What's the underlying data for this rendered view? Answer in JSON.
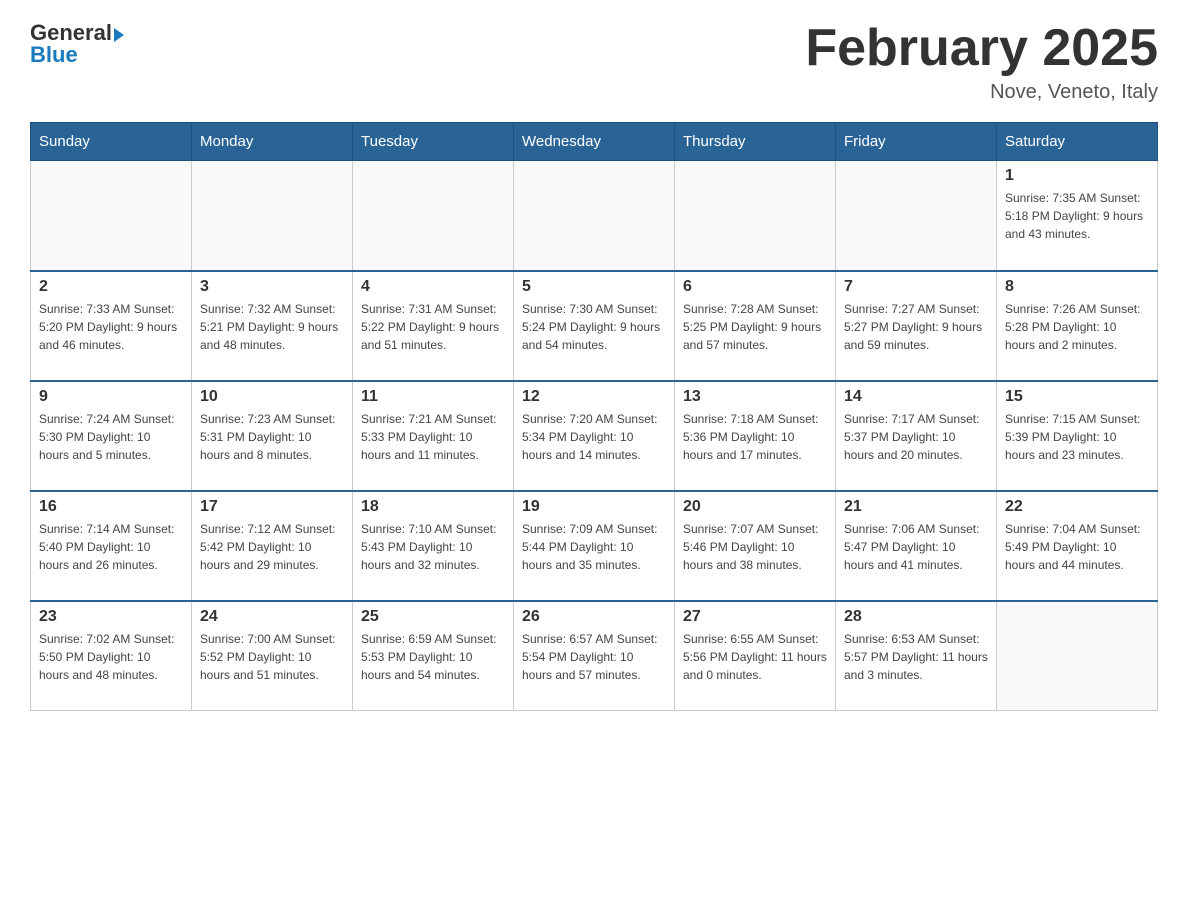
{
  "header": {
    "logo_general": "General",
    "logo_blue": "Blue",
    "month_title": "February 2025",
    "location": "Nove, Veneto, Italy"
  },
  "days_of_week": [
    "Sunday",
    "Monday",
    "Tuesday",
    "Wednesday",
    "Thursday",
    "Friday",
    "Saturday"
  ],
  "weeks": [
    [
      {
        "day": "",
        "info": ""
      },
      {
        "day": "",
        "info": ""
      },
      {
        "day": "",
        "info": ""
      },
      {
        "day": "",
        "info": ""
      },
      {
        "day": "",
        "info": ""
      },
      {
        "day": "",
        "info": ""
      },
      {
        "day": "1",
        "info": "Sunrise: 7:35 AM\nSunset: 5:18 PM\nDaylight: 9 hours and 43 minutes."
      }
    ],
    [
      {
        "day": "2",
        "info": "Sunrise: 7:33 AM\nSunset: 5:20 PM\nDaylight: 9 hours and 46 minutes."
      },
      {
        "day": "3",
        "info": "Sunrise: 7:32 AM\nSunset: 5:21 PM\nDaylight: 9 hours and 48 minutes."
      },
      {
        "day": "4",
        "info": "Sunrise: 7:31 AM\nSunset: 5:22 PM\nDaylight: 9 hours and 51 minutes."
      },
      {
        "day": "5",
        "info": "Sunrise: 7:30 AM\nSunset: 5:24 PM\nDaylight: 9 hours and 54 minutes."
      },
      {
        "day": "6",
        "info": "Sunrise: 7:28 AM\nSunset: 5:25 PM\nDaylight: 9 hours and 57 minutes."
      },
      {
        "day": "7",
        "info": "Sunrise: 7:27 AM\nSunset: 5:27 PM\nDaylight: 9 hours and 59 minutes."
      },
      {
        "day": "8",
        "info": "Sunrise: 7:26 AM\nSunset: 5:28 PM\nDaylight: 10 hours and 2 minutes."
      }
    ],
    [
      {
        "day": "9",
        "info": "Sunrise: 7:24 AM\nSunset: 5:30 PM\nDaylight: 10 hours and 5 minutes."
      },
      {
        "day": "10",
        "info": "Sunrise: 7:23 AM\nSunset: 5:31 PM\nDaylight: 10 hours and 8 minutes."
      },
      {
        "day": "11",
        "info": "Sunrise: 7:21 AM\nSunset: 5:33 PM\nDaylight: 10 hours and 11 minutes."
      },
      {
        "day": "12",
        "info": "Sunrise: 7:20 AM\nSunset: 5:34 PM\nDaylight: 10 hours and 14 minutes."
      },
      {
        "day": "13",
        "info": "Sunrise: 7:18 AM\nSunset: 5:36 PM\nDaylight: 10 hours and 17 minutes."
      },
      {
        "day": "14",
        "info": "Sunrise: 7:17 AM\nSunset: 5:37 PM\nDaylight: 10 hours and 20 minutes."
      },
      {
        "day": "15",
        "info": "Sunrise: 7:15 AM\nSunset: 5:39 PM\nDaylight: 10 hours and 23 minutes."
      }
    ],
    [
      {
        "day": "16",
        "info": "Sunrise: 7:14 AM\nSunset: 5:40 PM\nDaylight: 10 hours and 26 minutes."
      },
      {
        "day": "17",
        "info": "Sunrise: 7:12 AM\nSunset: 5:42 PM\nDaylight: 10 hours and 29 minutes."
      },
      {
        "day": "18",
        "info": "Sunrise: 7:10 AM\nSunset: 5:43 PM\nDaylight: 10 hours and 32 minutes."
      },
      {
        "day": "19",
        "info": "Sunrise: 7:09 AM\nSunset: 5:44 PM\nDaylight: 10 hours and 35 minutes."
      },
      {
        "day": "20",
        "info": "Sunrise: 7:07 AM\nSunset: 5:46 PM\nDaylight: 10 hours and 38 minutes."
      },
      {
        "day": "21",
        "info": "Sunrise: 7:06 AM\nSunset: 5:47 PM\nDaylight: 10 hours and 41 minutes."
      },
      {
        "day": "22",
        "info": "Sunrise: 7:04 AM\nSunset: 5:49 PM\nDaylight: 10 hours and 44 minutes."
      }
    ],
    [
      {
        "day": "23",
        "info": "Sunrise: 7:02 AM\nSunset: 5:50 PM\nDaylight: 10 hours and 48 minutes."
      },
      {
        "day": "24",
        "info": "Sunrise: 7:00 AM\nSunset: 5:52 PM\nDaylight: 10 hours and 51 minutes."
      },
      {
        "day": "25",
        "info": "Sunrise: 6:59 AM\nSunset: 5:53 PM\nDaylight: 10 hours and 54 minutes."
      },
      {
        "day": "26",
        "info": "Sunrise: 6:57 AM\nSunset: 5:54 PM\nDaylight: 10 hours and 57 minutes."
      },
      {
        "day": "27",
        "info": "Sunrise: 6:55 AM\nSunset: 5:56 PM\nDaylight: 11 hours and 0 minutes."
      },
      {
        "day": "28",
        "info": "Sunrise: 6:53 AM\nSunset: 5:57 PM\nDaylight: 11 hours and 3 minutes."
      },
      {
        "day": "",
        "info": ""
      }
    ]
  ]
}
